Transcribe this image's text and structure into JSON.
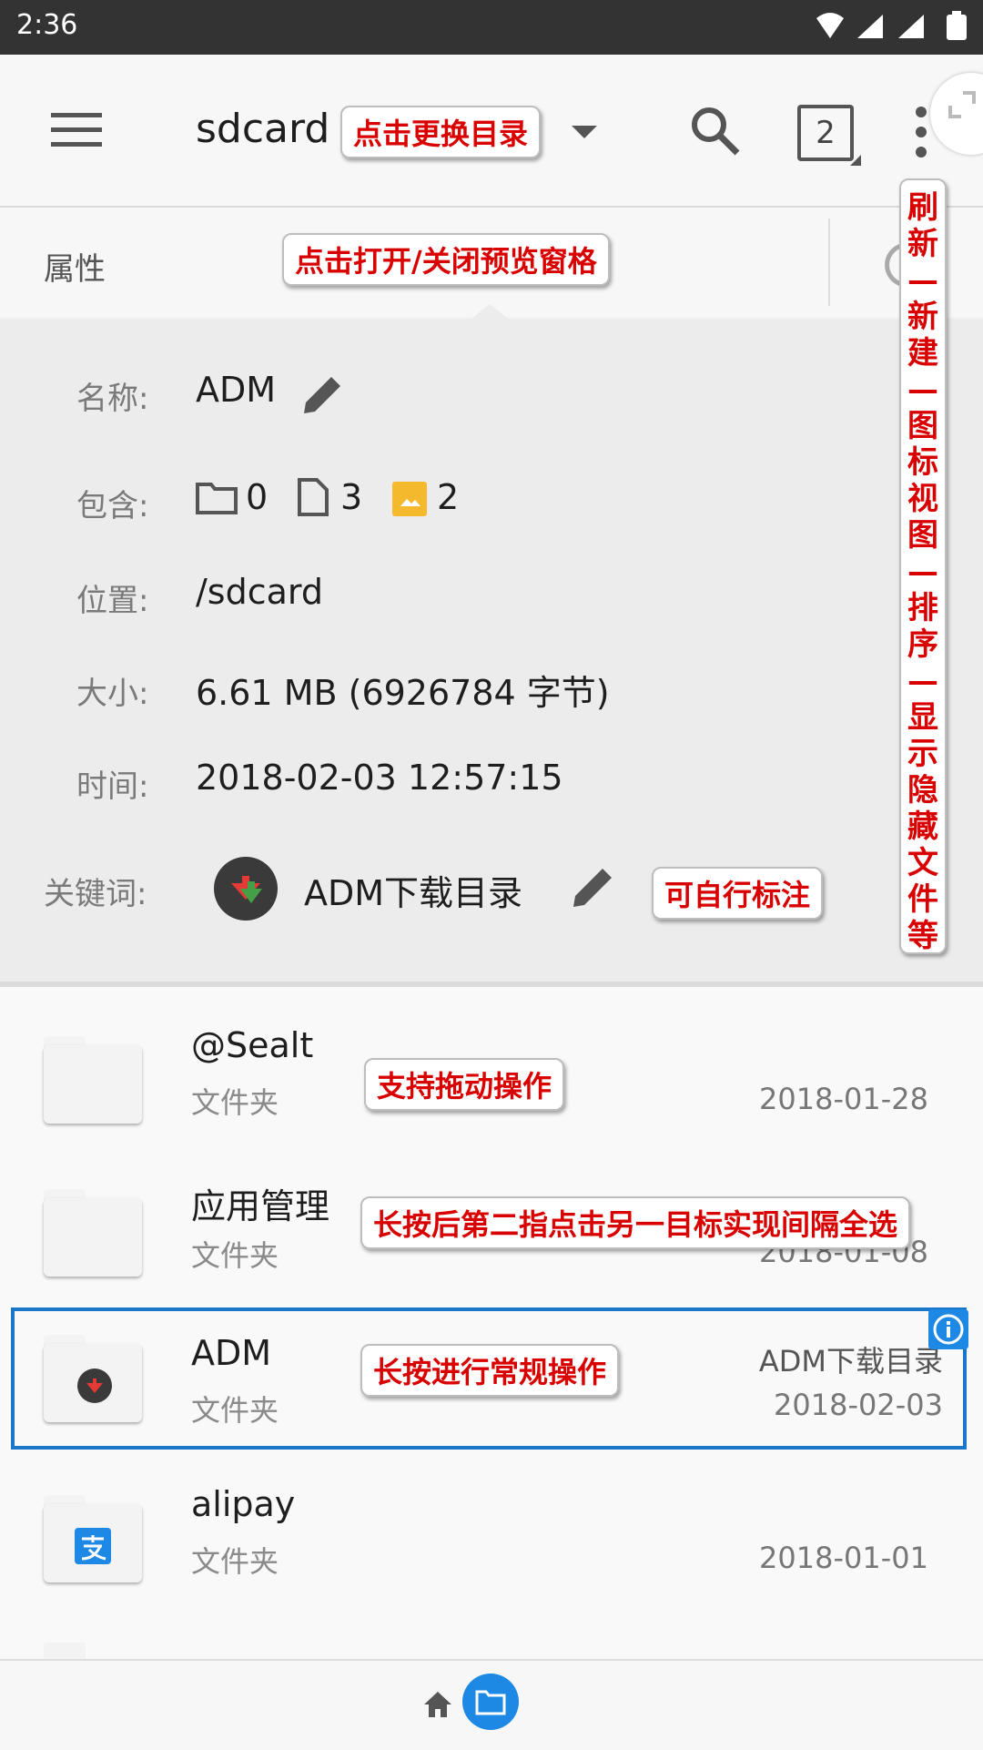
{
  "status": {
    "time": "2:36"
  },
  "toolbar": {
    "location": "sdcard",
    "window_count": "2",
    "note_change_dir": "点击更换目录"
  },
  "tabbar": {
    "tab_label": "属性",
    "note_preview": "点击打开/关闭预览窗格"
  },
  "side_note": "刷新—新建—图标视图—排序—显示隐藏文件等",
  "properties": {
    "name_label": "名称:",
    "name_value": "ADM",
    "contains_label": "包含:",
    "folders_count": "0",
    "files_count": "3",
    "images_count": "2",
    "location_label": "位置:",
    "location_value": "/sdcard",
    "size_label": "大小:",
    "size_value": "6.61 MB (6926784 字节)",
    "time_label": "时间:",
    "time_value": "2018-02-03 12:57:15",
    "keyword_label": "关键词:",
    "keyword_value": "ADM下载目录",
    "note_keyword": "可自行标注"
  },
  "files": [
    {
      "name": "@Sealt",
      "type": "文件夹",
      "tag": "",
      "date": "2018-01-28",
      "note": "支持拖动操作"
    },
    {
      "name": "应用管理",
      "type": "文件夹",
      "tag": "",
      "date": "2018-01-08",
      "note": "长按后第二指点击另一目标实现间隔全选"
    },
    {
      "name": "ADM",
      "type": "文件夹",
      "tag": "ADM下载目录",
      "date": "2018-02-03",
      "note": "长按进行常规操作"
    },
    {
      "name": "alipay",
      "type": "文件夹",
      "tag": "",
      "date": "2018-01-01",
      "note": ""
    }
  ],
  "colors": {
    "accent": "#1e88e5",
    "selection_border": "#1976c8",
    "note_text": "#d90000"
  }
}
